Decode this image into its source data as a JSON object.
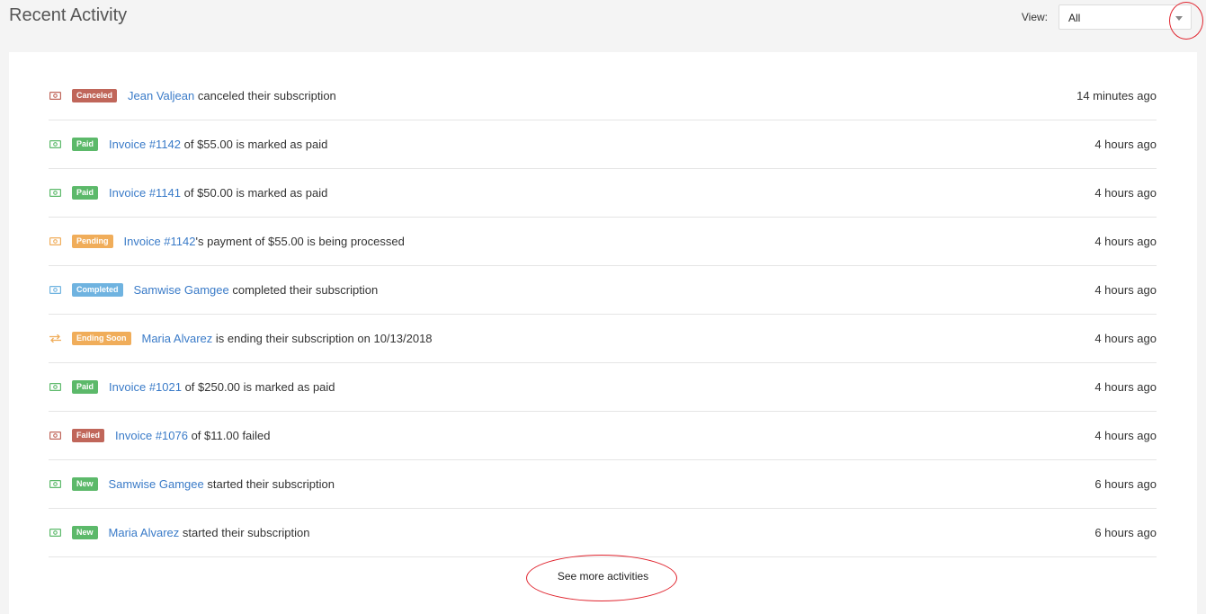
{
  "header": {
    "title": "Recent Activity",
    "view_label": "View:",
    "view_value": "All"
  },
  "colors": {
    "red": "#c0665a",
    "green": "#5cb96a",
    "orange": "#f0ad5a",
    "blue": "#6fb3e0",
    "link": "#3a7bc8",
    "annotation": "#e0242e"
  },
  "activities": [
    {
      "icon": "money-icon",
      "icon_color": "#c0665a",
      "badge": "Canceled",
      "badge_color": "#c0665a",
      "link": "Jean Valjean",
      "text": " canceled their subscription",
      "time": "14 minutes ago"
    },
    {
      "icon": "money-icon",
      "icon_color": "#5cb96a",
      "badge": "Paid",
      "badge_color": "#5cb96a",
      "link": "Invoice #1142",
      "text": " of $55.00 is marked as paid",
      "time": "4 hours ago"
    },
    {
      "icon": "money-icon",
      "icon_color": "#5cb96a",
      "badge": "Paid",
      "badge_color": "#5cb96a",
      "link": "Invoice #1141",
      "text": " of $50.00 is marked as paid",
      "time": "4 hours ago"
    },
    {
      "icon": "money-icon",
      "icon_color": "#f0ad5a",
      "badge": "Pending",
      "badge_color": "#f0ad5a",
      "link": "Invoice #1142",
      "text": "'s payment of $55.00 is being processed",
      "time": "4 hours ago"
    },
    {
      "icon": "money-icon",
      "icon_color": "#6fb3e0",
      "badge": "Completed",
      "badge_color": "#6fb3e0",
      "link": "Samwise Gamgee",
      "text": " completed their subscription",
      "time": "4 hours ago"
    },
    {
      "icon": "exchange-icon",
      "icon_color": "#f0ad5a",
      "badge": "Ending Soon",
      "badge_color": "#f0ad5a",
      "link": "Maria Alvarez",
      "text": " is ending their subscription on 10/13/2018",
      "time": "4 hours ago"
    },
    {
      "icon": "money-icon",
      "icon_color": "#5cb96a",
      "badge": "Paid",
      "badge_color": "#5cb96a",
      "link": "Invoice #1021",
      "text": " of $250.00 is marked as paid",
      "time": "4 hours ago"
    },
    {
      "icon": "money-icon",
      "icon_color": "#c0665a",
      "badge": "Failed",
      "badge_color": "#c0665a",
      "link": "Invoice #1076",
      "text": " of $11.00 failed",
      "time": "4 hours ago"
    },
    {
      "icon": "money-icon",
      "icon_color": "#5cb96a",
      "badge": "New",
      "badge_color": "#5cb96a",
      "link": "Samwise Gamgee",
      "text": " started their subscription",
      "time": "6 hours ago"
    },
    {
      "icon": "money-icon",
      "icon_color": "#5cb96a",
      "badge": "New",
      "badge_color": "#5cb96a",
      "link": "Maria Alvarez",
      "text": " started their subscription",
      "time": "6 hours ago"
    }
  ],
  "footer": {
    "see_more": "See more activities"
  }
}
